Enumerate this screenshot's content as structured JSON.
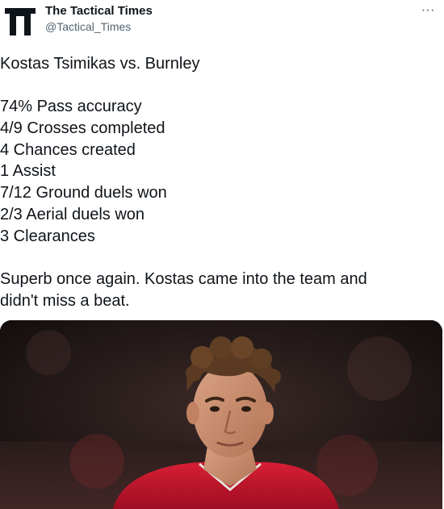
{
  "account": {
    "display_name": "The Tactical Times",
    "handle": "@Tactical_Times",
    "avatar_icon": "tt-logo-icon"
  },
  "menu": {
    "more_label": "···",
    "more_icon": "more-horizontal-icon"
  },
  "tweet": {
    "lines": [
      "Kostas Tsimikas vs. Burnley",
      "",
      "74% Pass accuracy",
      "4/9 Crosses completed",
      "4 Chances created",
      "1 Assist",
      "7/12 Ground duels won",
      "2/3 Aerial duels won",
      "3 Clearances",
      "",
      "Superb once again. Kostas came into the team and",
      "didn't miss a beat."
    ]
  },
  "media": {
    "kind": "photo",
    "subject": "player-portrait",
    "colors": {
      "background": "#1b1414",
      "shirt": "#c8102e",
      "skin": "#c98f6e",
      "hair": "#5a3a22"
    }
  },
  "colors": {
    "text": "#0f1419",
    "secondary": "#536471"
  }
}
